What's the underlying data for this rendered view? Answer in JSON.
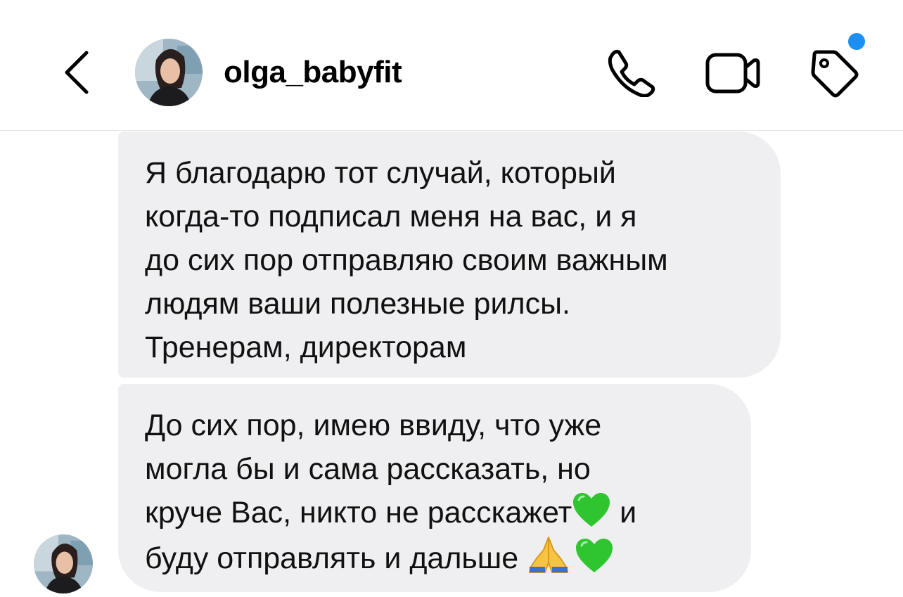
{
  "header": {
    "username": "olga_babyfit",
    "notification_dot_color": "#1d8ff2",
    "icons": [
      "chevron-left-icon",
      "phone-icon",
      "video-camera-icon",
      "tag-icon"
    ]
  },
  "messages": [
    {
      "lines": [
        "Я благодарю тот случай, который",
        "когда-то подписал меня на вас, и я",
        "до сих пор отправляю своим важным",
        "людям ваши полезные рилсы.",
        "Тренерам, директорам"
      ]
    },
    {
      "lines": [
        "До сих пор, имею ввиду, что уже",
        "могла бы и сама рассказать, но",
        "круче Вас, никто не расскажет",
        " и",
        "буду отправлять и дальше "
      ],
      "emojis": [
        "green-heart",
        "folded-hands",
        "green-heart"
      ]
    }
  ],
  "colors": {
    "bubble_bg": "#efeff1",
    "heart": "#2fc52f"
  }
}
